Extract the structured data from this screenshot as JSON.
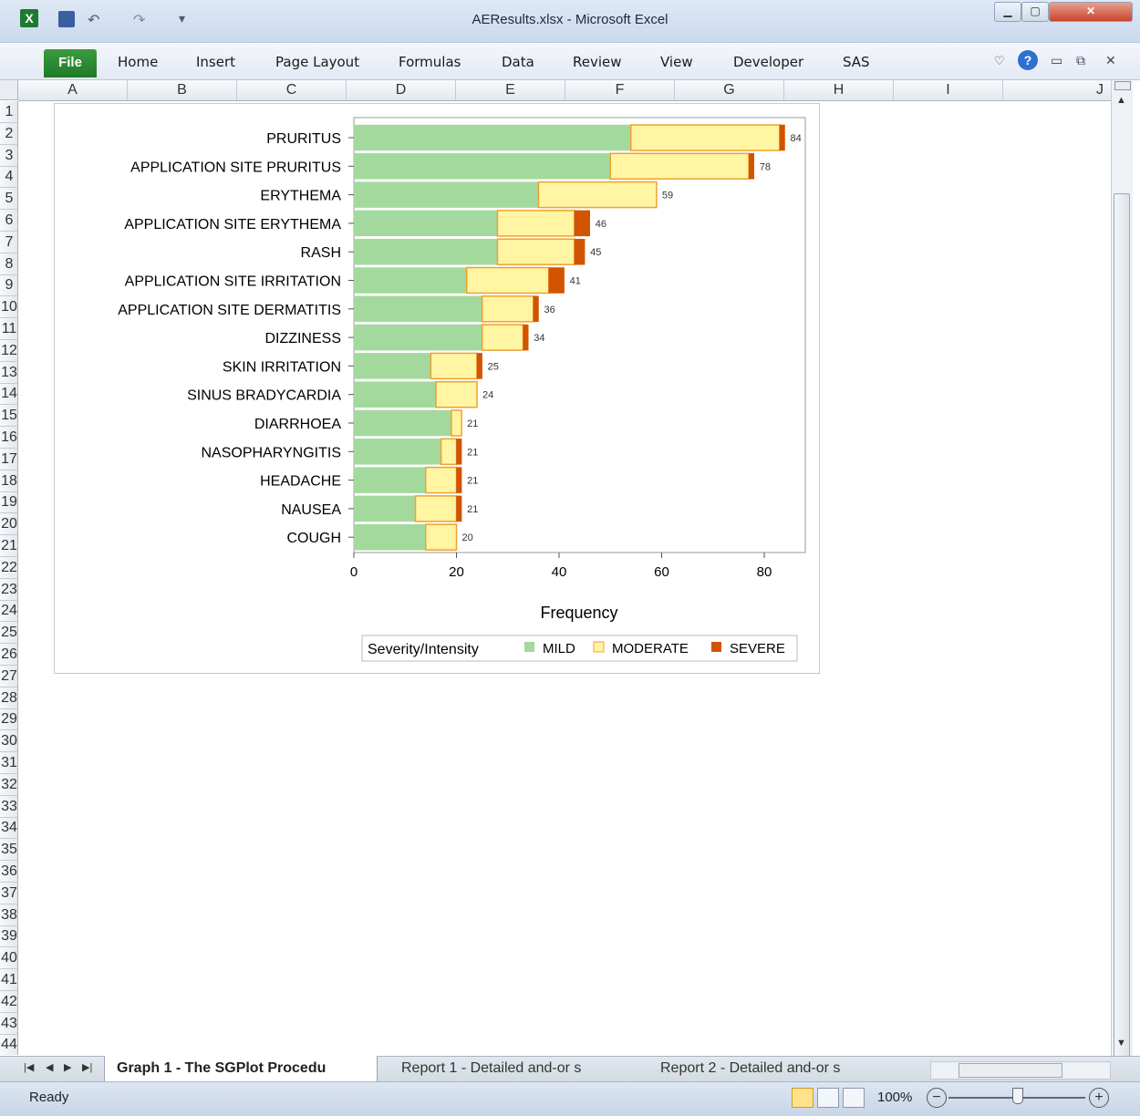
{
  "window": {
    "title": "AEResults.xlsx - Microsoft Excel"
  },
  "ribbon": {
    "file_label": "File",
    "tabs": [
      "Home",
      "Insert",
      "Page Layout",
      "Formulas",
      "Data",
      "Review",
      "View",
      "Developer",
      "SAS"
    ]
  },
  "grid": {
    "columns": [
      "A",
      "B",
      "C",
      "D",
      "E",
      "F",
      "G",
      "H",
      "I",
      "J"
    ],
    "rows": [
      "1",
      "2",
      "3",
      "4",
      "5",
      "6",
      "7",
      "8",
      "9",
      "10",
      "11",
      "12",
      "13",
      "14",
      "15",
      "16",
      "17",
      "18",
      "19",
      "20",
      "21",
      "22",
      "23",
      "24",
      "25",
      "26",
      "27",
      "28",
      "29",
      "30",
      "31",
      "32",
      "33",
      "34",
      "35",
      "36",
      "37",
      "38",
      "39",
      "40",
      "41",
      "42",
      "43",
      "44"
    ]
  },
  "sheet_tabs": [
    "Graph 1 - The SGPlot Procedu",
    "Report 1 - Detailed and-or s",
    "Report 2 - Detailed and-or s"
  ],
  "status": {
    "ready": "Ready",
    "zoom": "100%"
  },
  "colors": {
    "mild": "#a3d99d",
    "moderate": "#fff5a3",
    "moderate_border": "#f0a030",
    "severe": "#d35400"
  },
  "chart_data": {
    "type": "bar",
    "orientation": "horizontal",
    "stacked": true,
    "categories": [
      "PRURITUS",
      "APPLICATION SITE PRURITUS",
      "ERYTHEMA",
      "APPLICATION SITE ERYTHEMA",
      "RASH",
      "APPLICATION SITE IRRITATION",
      "APPLICATION SITE DERMATITIS",
      "DIZZINESS",
      "SKIN IRRITATION",
      "SINUS BRADYCARDIA",
      "DIARRHOEA",
      "NASOPHARYNGITIS",
      "HEADACHE",
      "NAUSEA",
      "COUGH"
    ],
    "series": [
      {
        "name": "MILD",
        "values": [
          54,
          50,
          36,
          28,
          28,
          22,
          25,
          25,
          15,
          16,
          19,
          17,
          14,
          12,
          14
        ]
      },
      {
        "name": "MODERATE",
        "values": [
          29,
          27,
          23,
          15,
          15,
          16,
          10,
          8,
          9,
          8,
          2,
          3,
          6,
          8,
          6
        ]
      },
      {
        "name": "SEVERE",
        "values": [
          1,
          1,
          0,
          3,
          2,
          3,
          1,
          1,
          1,
          0,
          0,
          1,
          1,
          1,
          0
        ]
      }
    ],
    "totals": [
      84,
      78,
      59,
      46,
      45,
      41,
      36,
      34,
      25,
      24,
      21,
      21,
      21,
      21,
      20
    ],
    "xlabel": "Frequency",
    "xlim": [
      0,
      88
    ],
    "xticks": [
      0,
      20,
      40,
      60,
      80
    ],
    "legend_title": "Severity/Intensity",
    "legend_position": "bottom"
  }
}
